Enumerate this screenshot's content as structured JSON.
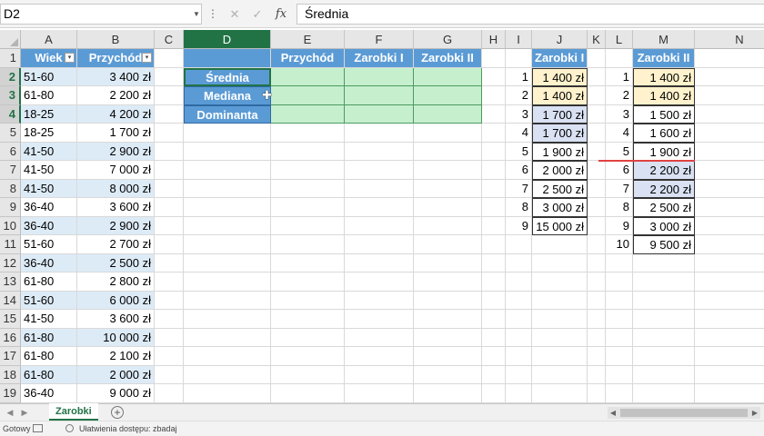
{
  "formula_bar": {
    "name_box": "D2",
    "cancel_icon": "✕",
    "enter_icon": "✓",
    "fx_label": "fx",
    "formula": "Średnia"
  },
  "columns": [
    "A",
    "B",
    "C",
    "D",
    "E",
    "F",
    "G",
    "H",
    "I",
    "J",
    "K",
    "L",
    "M",
    "N"
  ],
  "selected_column": "D",
  "rows": [
    "1",
    "2",
    "3",
    "4",
    "5",
    "6",
    "7",
    "8",
    "9",
    "10",
    "11",
    "12",
    "13",
    "14",
    "15",
    "16",
    "17",
    "18",
    "19"
  ],
  "selected_rows": [
    "2",
    "3",
    "4"
  ],
  "table1": {
    "headers": [
      "Wiek",
      "Przychód"
    ],
    "filter_icon": "▾",
    "rows": [
      [
        "51-60",
        "3 400 zł"
      ],
      [
        "61-80",
        "2 200 zł"
      ],
      [
        "18-25",
        "4 200 zł"
      ],
      [
        "18-25",
        "1 700 zł"
      ],
      [
        "41-50",
        "2 900 zł"
      ],
      [
        "41-50",
        "7 000 zł"
      ],
      [
        "41-50",
        "8 000 zł"
      ],
      [
        "36-40",
        "3 600 zł"
      ],
      [
        "36-40",
        "2 900 zł"
      ],
      [
        "51-60",
        "2 700 zł"
      ],
      [
        "36-40",
        "2 500 zł"
      ],
      [
        "61-80",
        "2 800 zł"
      ],
      [
        "51-60",
        "6 000 zł"
      ],
      [
        "41-50",
        "3 600 zł"
      ],
      [
        "61-80",
        "10 000 zł"
      ],
      [
        "61-80",
        "2 100 zł"
      ],
      [
        "61-80",
        "2 000 zł"
      ],
      [
        "36-40",
        "9 000 zł"
      ]
    ]
  },
  "summary": {
    "headers": [
      "Przychód",
      "Zarobki I",
      "Zarobki II"
    ],
    "labels": [
      "Średnia",
      "Mediana",
      "Dominanta"
    ]
  },
  "zarobki1": {
    "header": "Zarobki I",
    "index": [
      "1",
      "2",
      "3",
      "4",
      "5",
      "6",
      "7",
      "8",
      "9"
    ],
    "values": [
      "1 400 zł",
      "1 400 zł",
      "1 700 zł",
      "1 700 zł",
      "1 900 zł",
      "2 000 zł",
      "2 500 zł",
      "3 000 zł",
      "15 000 zł"
    ],
    "highlight": [
      "yellow",
      "yellow",
      "blue",
      "blue",
      "",
      "",
      "",
      "",
      ""
    ]
  },
  "zarobki2": {
    "header": "Zarobki II",
    "index": [
      "1",
      "2",
      "3",
      "4",
      "5",
      "6",
      "7",
      "8",
      "9",
      "10"
    ],
    "values": [
      "1 400 zł",
      "1 400 zł",
      "1 500 zł",
      "1 600 zł",
      "1 900 zł",
      "2 200 zł",
      "2 200 zł",
      "2 500 zł",
      "3 000 zł",
      "9 500 zł"
    ],
    "highlight": [
      "yellow",
      "yellow",
      "",
      "",
      "",
      "blue",
      "blue",
      "",
      "",
      ""
    ]
  },
  "sheet_tabs": {
    "active": "Zarobki",
    "add_icon": "+"
  },
  "status_bar": {
    "ready": "Gotowy",
    "accessibility": "Ułatwienia dostępu: zbadaj"
  },
  "colors": {
    "header_blue": "#5b9bd5",
    "band_light_blue": "#ddebf7",
    "summary_green": "#c6efce",
    "highlight_yellow": "#fff2cc",
    "highlight_blue": "#d9e1f2",
    "excel_green": "#217346",
    "median_divider_red": "#e04141"
  }
}
